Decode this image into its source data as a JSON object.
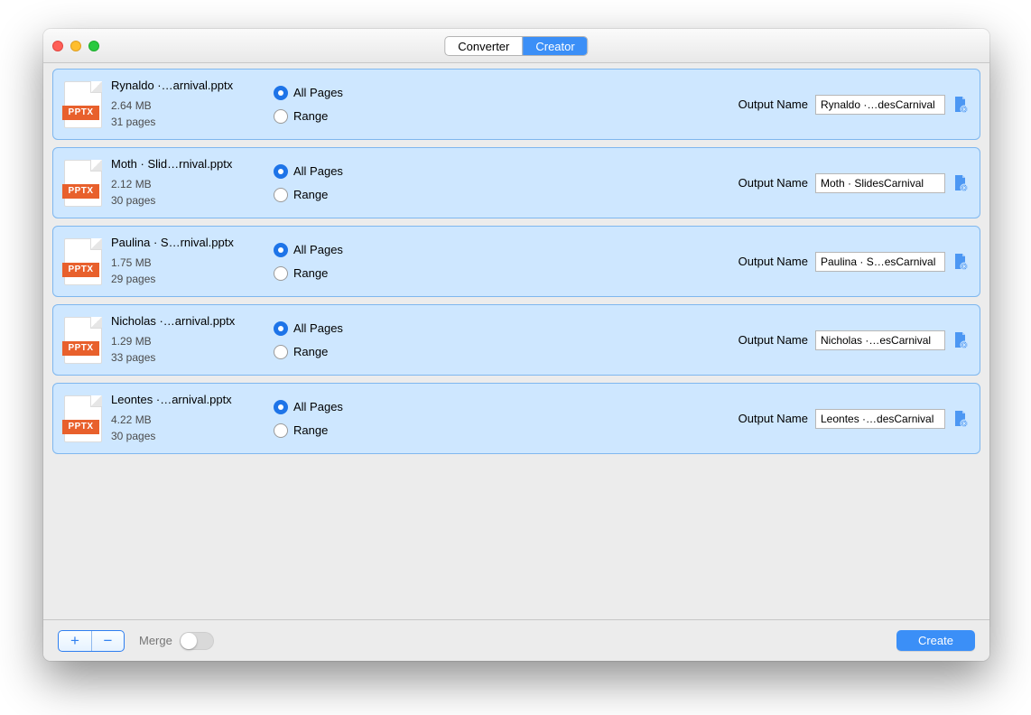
{
  "titlebar": {
    "segments": [
      {
        "label": "Converter",
        "active": false
      },
      {
        "label": "Creator",
        "active": true
      }
    ]
  },
  "file_badge": "PPTX",
  "radio_labels": {
    "all": "All Pages",
    "range": "Range"
  },
  "output_label": "Output Name",
  "files": [
    {
      "name": "Rynaldo ·…arnival.pptx",
      "size": "2.64 MB",
      "pages": "31 pages",
      "output": "Rynaldo ·…desCarnival"
    },
    {
      "name": "Moth · Slid…rnival.pptx",
      "size": "2.12 MB",
      "pages": "30 pages",
      "output": "Moth · SlidesCarnival"
    },
    {
      "name": "Paulina · S…rnival.pptx",
      "size": "1.75 MB",
      "pages": "29 pages",
      "output": "Paulina · S…esCarnival"
    },
    {
      "name": "Nicholas ·…arnival.pptx",
      "size": "1.29 MB",
      "pages": "33 pages",
      "output": "Nicholas ·…esCarnival"
    },
    {
      "name": "Leontes ·…arnival.pptx",
      "size": "4.22 MB",
      "pages": "30 pages",
      "output": "Leontes ·…desCarnival"
    }
  ],
  "footer": {
    "merge_label": "Merge",
    "create_label": "Create"
  }
}
